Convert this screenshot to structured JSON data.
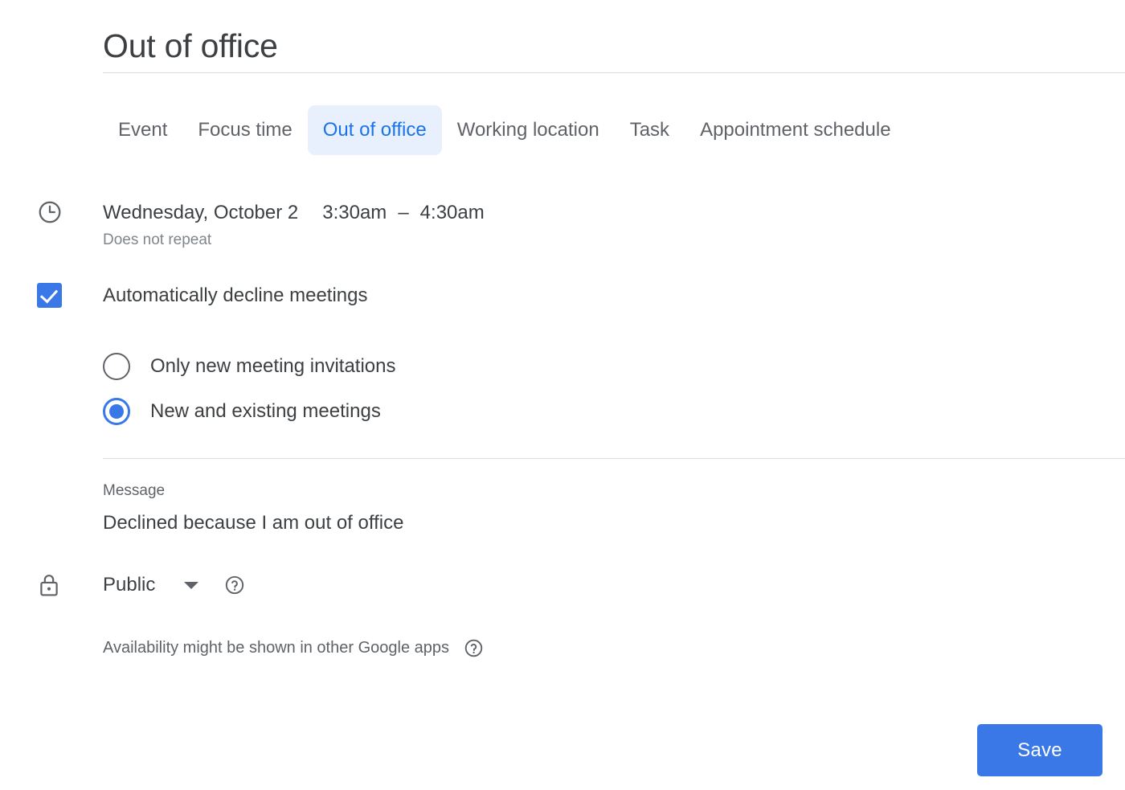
{
  "event": {
    "title": "Out of office"
  },
  "tabs": [
    {
      "label": "Event",
      "active": false
    },
    {
      "label": "Focus time",
      "active": false
    },
    {
      "label": "Out of office",
      "active": true
    },
    {
      "label": "Working location",
      "active": false
    },
    {
      "label": "Task",
      "active": false
    },
    {
      "label": "Appointment schedule",
      "active": false
    }
  ],
  "schedule": {
    "icon": "clock-icon",
    "date": "Wednesday, October 2",
    "start_time": "3:30am",
    "dash": "–",
    "end_time": "4:30am",
    "recurrence": "Does not repeat"
  },
  "auto_decline": {
    "label": "Automatically decline meetings",
    "checked": true,
    "options": [
      {
        "label": "Only new meeting invitations",
        "selected": false
      },
      {
        "label": "New and existing meetings",
        "selected": true
      }
    ]
  },
  "message": {
    "label": "Message",
    "value": "Declined because I am out of office"
  },
  "visibility": {
    "icon": "lock-icon",
    "value": "Public",
    "help_icon": "help-circle-icon"
  },
  "availability": {
    "note": "Availability might be shown in other Google apps",
    "help_icon": "help-circle-icon"
  },
  "actions": {
    "save_label": "Save"
  },
  "colors": {
    "accent": "#3b78e7",
    "accent_tab_text": "#1a73e8",
    "accent_tab_bg": "#e8f0fe",
    "text_primary": "#3c4043",
    "text_secondary": "#5f6368",
    "text_muted": "#80868b",
    "divider": "#dadce0"
  }
}
